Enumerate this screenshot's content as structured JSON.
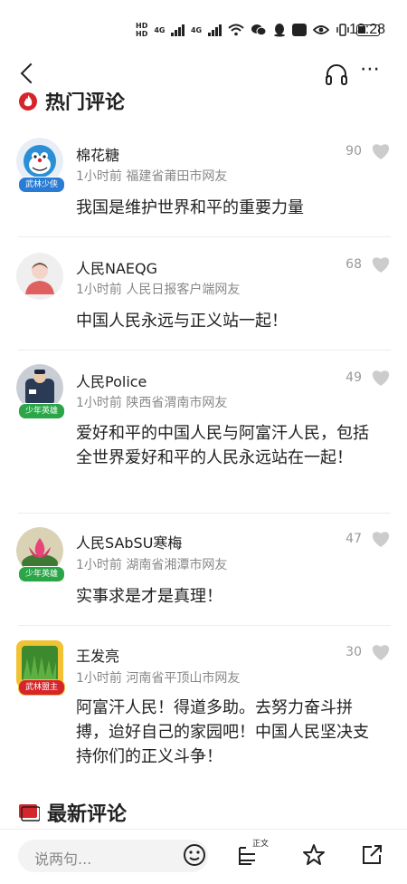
{
  "status_bar": {
    "hd1": "HD",
    "hd2": "HD",
    "net1": "4G",
    "net2": "4G",
    "time": "13:28"
  },
  "section_hot": {
    "title": "热门评论"
  },
  "comments": [
    {
      "name": "棉花糖",
      "time": "1小时前",
      "location": "福建省莆田市网友",
      "likes": "90",
      "badge": "武林少侠",
      "badge_color": "#2a7bd3",
      "text": "我国是维护世界和平的重要力量"
    },
    {
      "name": "人民NAEQG",
      "time": "1小时前",
      "location": "人民日报客户端网友",
      "likes": "68",
      "badge": "",
      "badge_color": "",
      "text": "中国人民永远与正义站一起！"
    },
    {
      "name": "人民Police",
      "time": "1小时前",
      "location": "陕西省渭南市网友",
      "likes": "49",
      "badge": "少年英雄",
      "badge_color": "#2aa548",
      "text": "爱好和平的中国人民与阿富汗人民，包括全世界爱好和平的人民永远站在一起！"
    },
    {
      "name": "人民SAbSU寒梅",
      "time": "1小时前",
      "location": "湖南省湘潭市网友",
      "likes": "47",
      "badge": "少年英雄",
      "badge_color": "#2aa548",
      "text": "实事求是才是真理！"
    },
    {
      "name": "王发亮",
      "time": "1小时前",
      "location": "河南省平顶山市网友",
      "likes": "30",
      "badge": "武林盟主",
      "badge_color": "#d6242b",
      "text": "阿富汗人民！得道多助。去努力奋斗拼搏，迨好自己的家园吧！中国人民坚决支持你们的正义斗争！"
    }
  ],
  "section_new": {
    "title": "最新评论"
  },
  "bottom_bar": {
    "input_placeholder": "说两句...",
    "text_label": "正文"
  },
  "colors": {
    "accent_red": "#d6242b",
    "meta_gray": "#888888",
    "heart_gray": "#cccccc"
  }
}
